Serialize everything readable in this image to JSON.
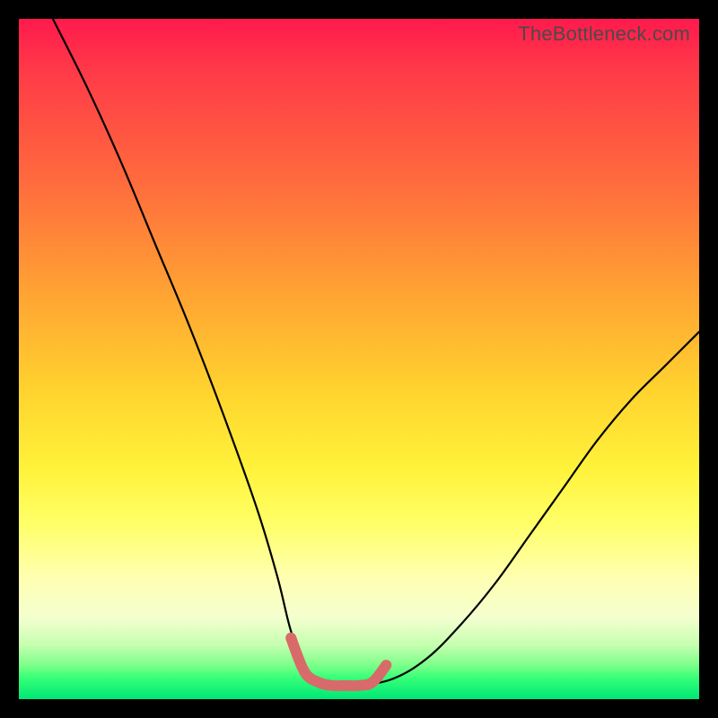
{
  "watermark": {
    "text": "TheBottleneck.com"
  },
  "chart_data": {
    "type": "line",
    "title": "",
    "xlabel": "",
    "ylabel": "",
    "xlim": [
      0,
      100
    ],
    "ylim": [
      0,
      100
    ],
    "gradient_stops": [
      {
        "pct": 0,
        "color": "#ff1a4d"
      },
      {
        "pct": 24,
        "color": "#ff6b3d"
      },
      {
        "pct": 55,
        "color": "#ffd42e"
      },
      {
        "pct": 74,
        "color": "#ffff66"
      },
      {
        "pct": 88,
        "color": "#f4ffd0"
      },
      {
        "pct": 97,
        "color": "#33ff77"
      },
      {
        "pct": 100,
        "color": "#00e676"
      }
    ],
    "series": [
      {
        "name": "bottleneck-curve",
        "stroke": "#000000",
        "x": [
          5,
          10,
          15,
          20,
          25,
          30,
          35,
          38,
          40,
          42,
          44,
          46,
          48,
          50,
          55,
          60,
          65,
          70,
          75,
          80,
          85,
          90,
          95,
          100
        ],
        "y": [
          100,
          90,
          79,
          67,
          55,
          42,
          28,
          18,
          10,
          5,
          3,
          2,
          2,
          2,
          3,
          6,
          11,
          17,
          24,
          31,
          38,
          44,
          49,
          54
        ]
      },
      {
        "name": "optimal-range-highlight",
        "stroke": "#d86a6a",
        "x": [
          40,
          42,
          44,
          46,
          48,
          50,
          52,
          54
        ],
        "y": [
          9,
          4,
          2.5,
          2,
          2,
          2,
          2.5,
          5
        ]
      }
    ]
  }
}
